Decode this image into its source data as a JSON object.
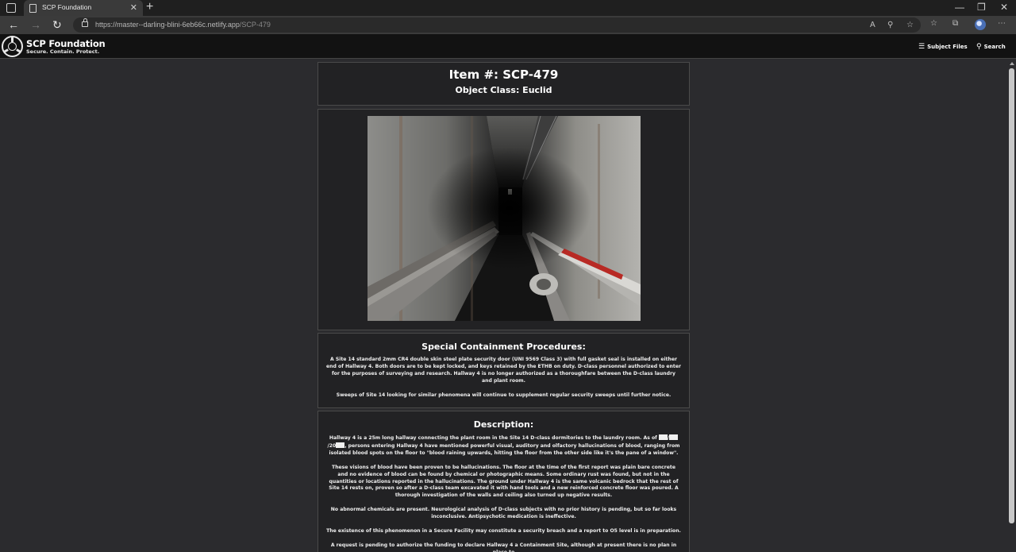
{
  "browser": {
    "tab_title": "SCP Foundation",
    "url_host": "https://master--darling-blini-6eb66c.netlify.app",
    "url_path": "/SCP-479"
  },
  "header": {
    "site_title": "SCP Foundation",
    "tagline": "Secure. Contain. Protect.",
    "subject_files": "Subject Files",
    "search": "Search"
  },
  "item": {
    "number": "Item #: SCP-479",
    "object_class": "Object Class: Euclid"
  },
  "containment": {
    "heading": "Special Containment Procedures:",
    "paragraphs": [
      "A Site 14 standard 2mm CR4 double skin steel plate security door (UNI 9569 Class 3) with full gasket seal is installed on either end of Hallway 4. Both doors are to be kept locked, and keys retained by the ETHB on duty. D-class personnel authorized to enter for the purposes of surveying and research. Hallway 4 is no longer authorized as a thoroughfare between the D-class laundry and plant room.",
      "Sweeps of Site 14 looking for similar phenomena will continue to supplement regular security sweeps until further notice."
    ]
  },
  "description": {
    "heading": "Description:",
    "p1_start": "Hallway 4 is a 25m long hallway connecting the plant room in the Site 14 D-class dormitories to the laundry room. As of ",
    "p1_date_sep1": "/",
    "p1_date_sep2": "/20",
    "p1_end": ", persons entering Hallway 4 have mentioned powerful visual, auditory and olfactory hallucinations of blood, ranging from isolated blood spots on the floor to \"blood raining upwards, hitting the floor from the other side like it's the pane of a window\".",
    "paragraphs": [
      "These visions of blood have been proven to be hallucinations. The floor at the time of the first report was plain bare concrete and no evidence of blood can be found by chemical or photographic means. Some ordinary rust was found, but not in the quantities or locations reported in the hallucinations. The ground under Hallway 4 is the same volcanic bedrock that the rest of Site 14 rests on, proven so after a D-class team excavated it with hand tools and a new reinforced concrete floor was poured. A thorough investigation of the walls and ceiling also turned up negative results.",
      "No abnormal chemicals are present. Neurological analysis of D-class subjects with no prior history is pending, but so far looks inconclusive. Antipsychotic medication is ineffective.",
      "The existence of this phenomenon in a Secure Facility may constitute a security breach and a report to O5 level is in preparation.",
      "A request is pending to authorize the funding to declare Hallway 4 a Containment Site, although at present there is no plan in place to"
    ]
  }
}
